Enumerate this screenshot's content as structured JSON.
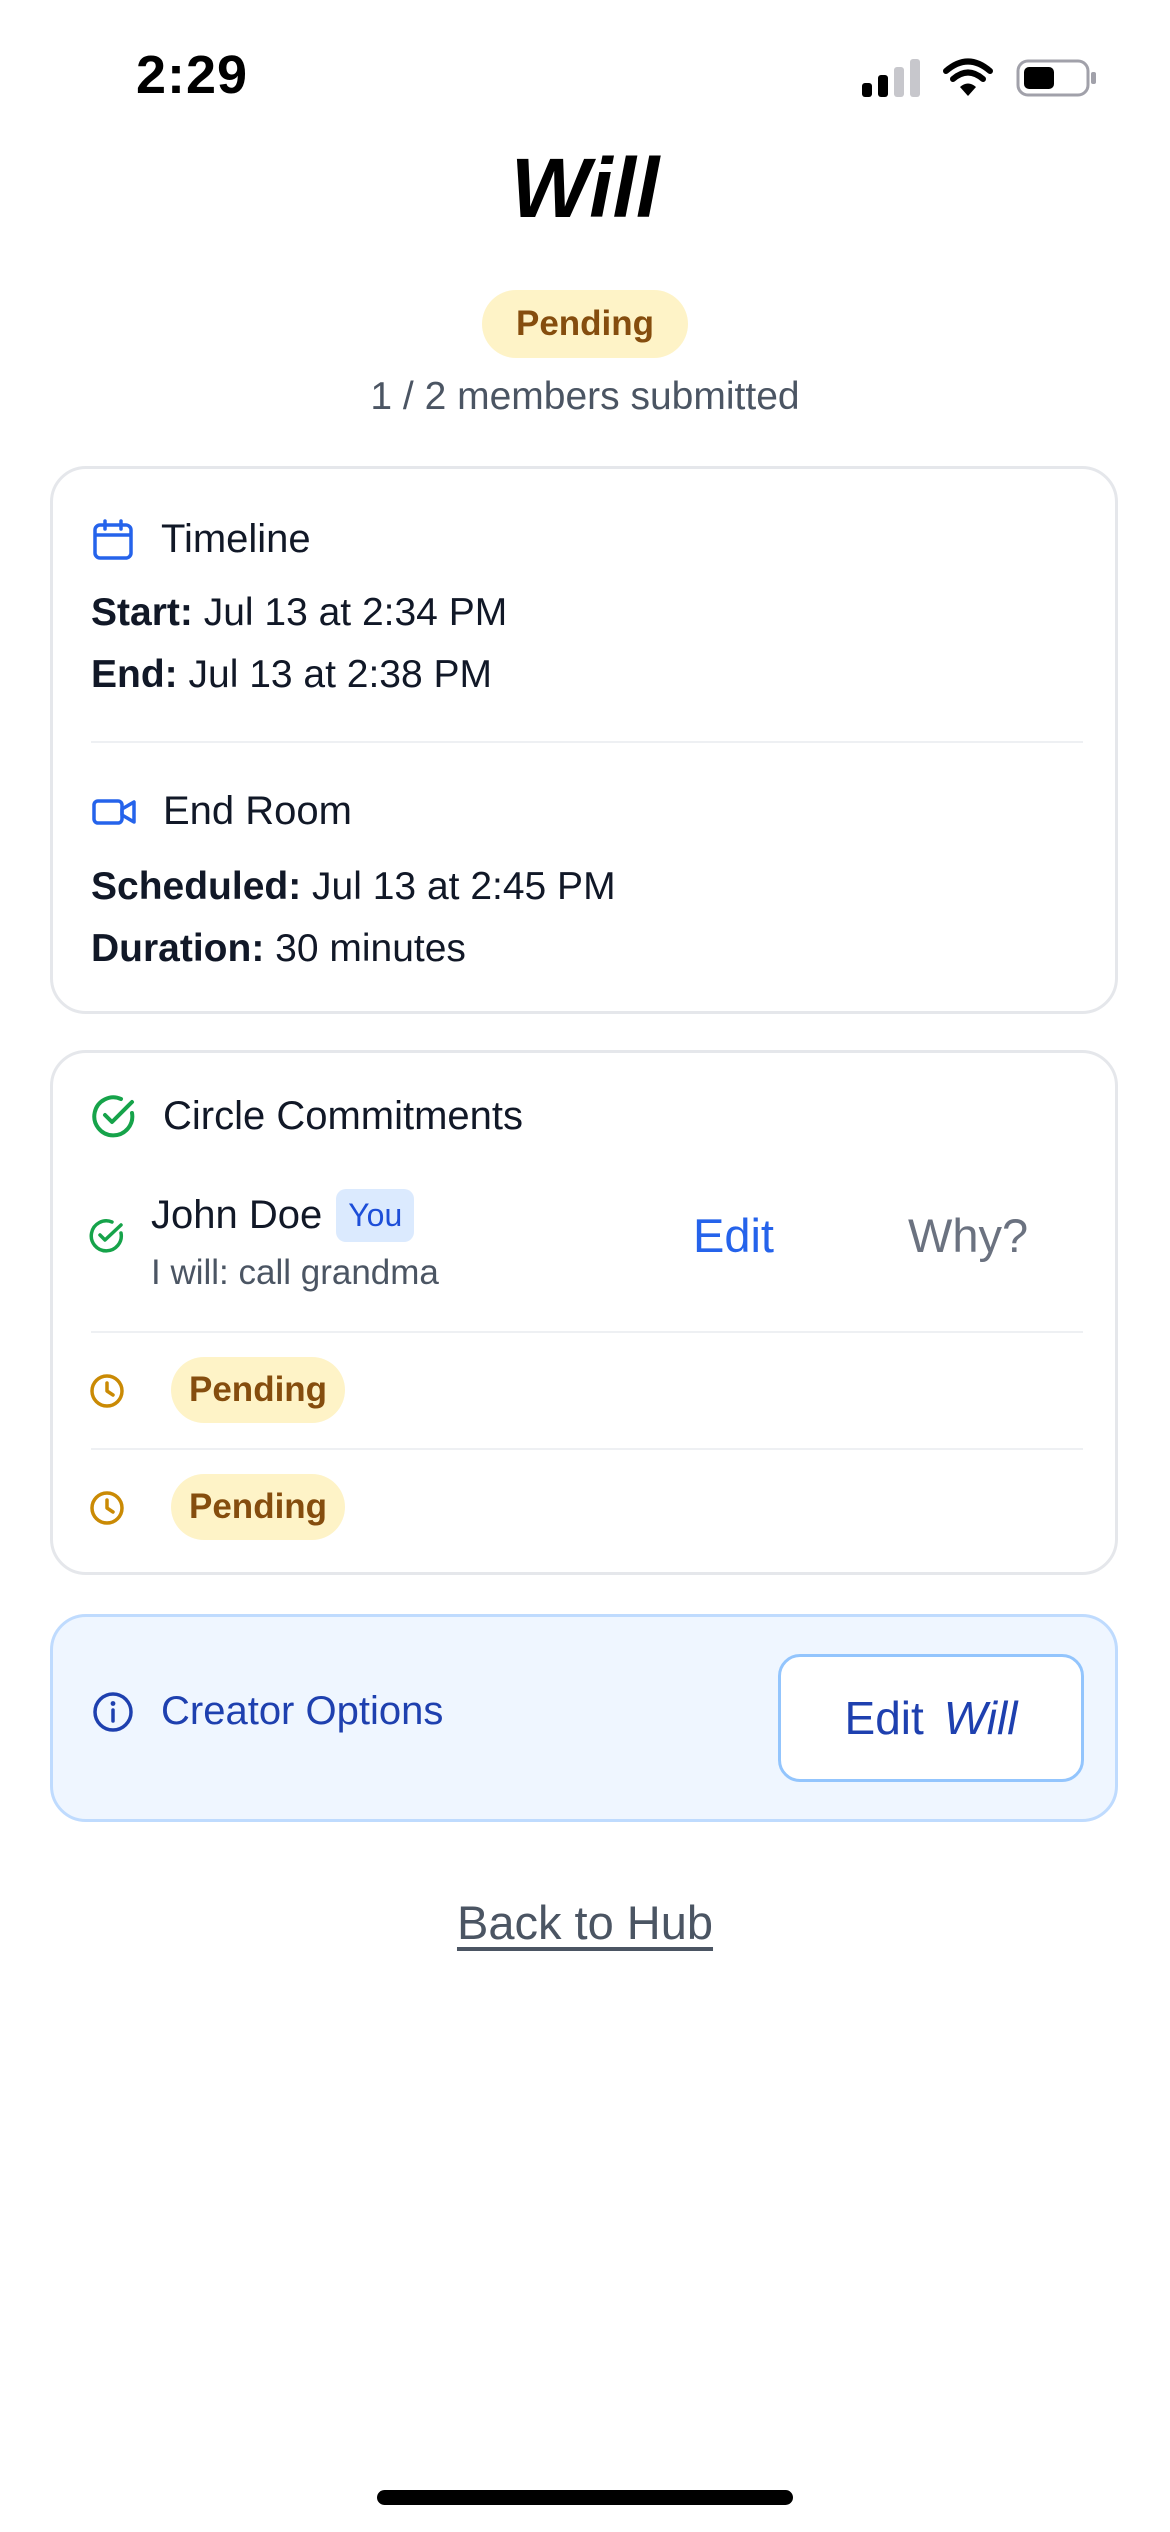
{
  "status_bar": {
    "time": "2:29"
  },
  "header": {
    "title": "Will",
    "status": "Pending",
    "submitted_text": "1 / 2 members submitted"
  },
  "timeline": {
    "heading": "Timeline",
    "start_label": "Start:",
    "start_value": "Jul 13 at 2:34 PM",
    "end_label": "End:",
    "end_value": "Jul 13 at 2:38 PM"
  },
  "end_room": {
    "heading": "End Room",
    "scheduled_label": "Scheduled:",
    "scheduled_value": "Jul 13 at 2:45 PM",
    "duration_label": "Duration:",
    "duration_value": "30 minutes"
  },
  "commitments": {
    "heading": "Circle Commitments",
    "members": [
      {
        "name": "John Doe",
        "badge": "You",
        "commitment": "I will: call grandma",
        "edit_label": "Edit",
        "why_label": "Why?"
      }
    ],
    "pending": [
      {
        "status": "Pending"
      },
      {
        "status": "Pending"
      }
    ]
  },
  "creator": {
    "label": "Creator Options",
    "edit_prefix": "Edit",
    "edit_suffix": "Will"
  },
  "footer": {
    "back_label": "Back to Hub"
  },
  "colors": {
    "accent": "#2563eb",
    "success": "#16a34a",
    "pending_bg": "#fef3c7",
    "pending_text": "#854d0e",
    "pending_icon": "#ca8a04"
  }
}
